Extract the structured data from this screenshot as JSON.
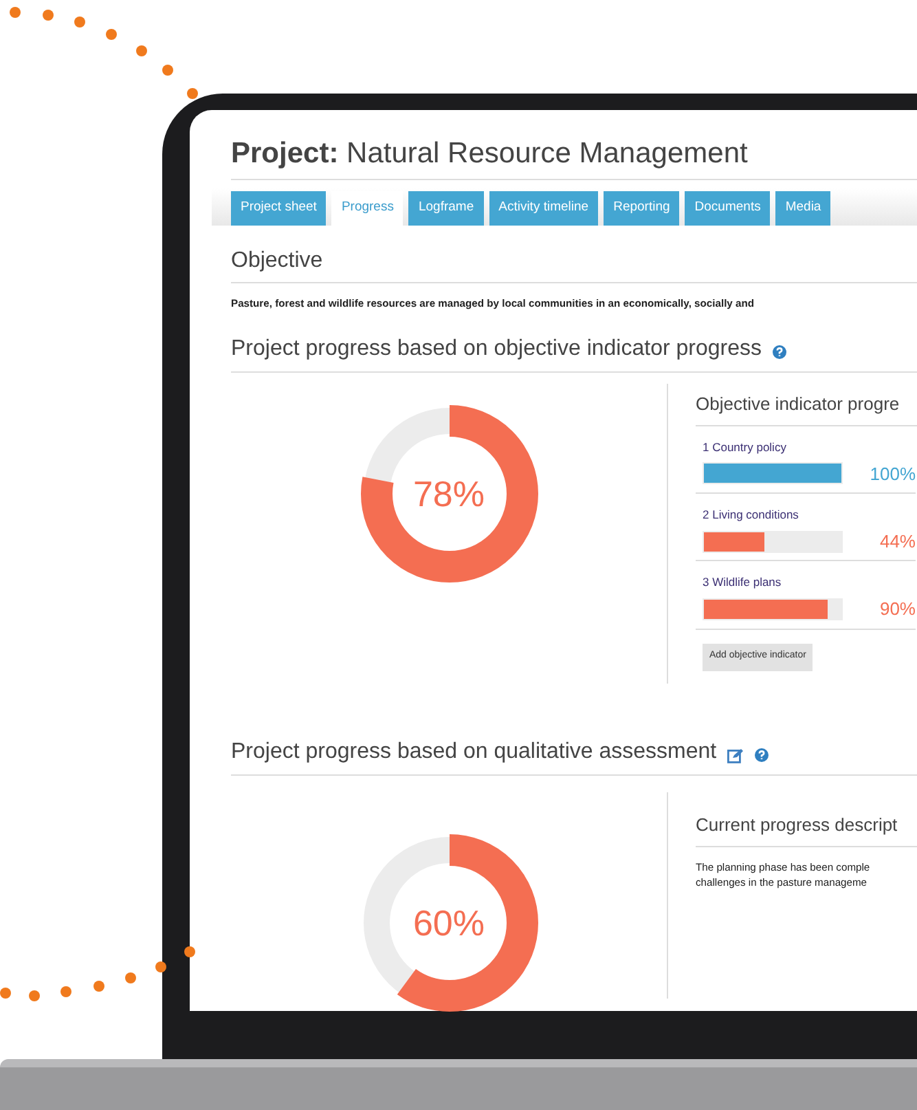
{
  "title": "**Project:** Natural Resource Management",
  "tabs": [
    {
      "label": "Project sheet",
      "selected": false
    },
    {
      "label": "Progress",
      "selected": true
    },
    {
      "label": "Logframe",
      "selected": false
    },
    {
      "label": "Activity timeline",
      "selected": false
    },
    {
      "label": "Reporting",
      "selected": false
    },
    {
      "label": "Documents",
      "selected": false
    },
    {
      "label": "Media",
      "selected": false
    }
  ],
  "objective": {
    "heading": "Objective",
    "text": "Pasture, forest and wildlife resources are managed by local communities in an economically, socially and"
  },
  "indicator_progress": {
    "heading": "Project progress based on objective indicator progress",
    "level": 0.78,
    "reading": "78%",
    "panel_heading": "Objective indicator progre",
    "indicators": [
      {
        "label": "1 Country policy",
        "level": 1,
        "reading": "100%",
        "color": "#44a6d2"
      },
      {
        "label": "2 Living conditions",
        "level": 0.44,
        "reading": "44%",
        "color": "#f46e52"
      },
      {
        "label": "3 Wildlife plans",
        "level": 0.9,
        "reading": "90%",
        "color": "#f46e52"
      }
    ],
    "add_button": "Add objective indicator"
  },
  "qualitative": {
    "heading": "Project progress based on qualitative assessment",
    "level": 0.6,
    "reading": "60%",
    "panel_heading": "Current progress descript",
    "description": [
      "The planning phase has been comple",
      "challenges in the pasture manageme"
    ]
  }
}
